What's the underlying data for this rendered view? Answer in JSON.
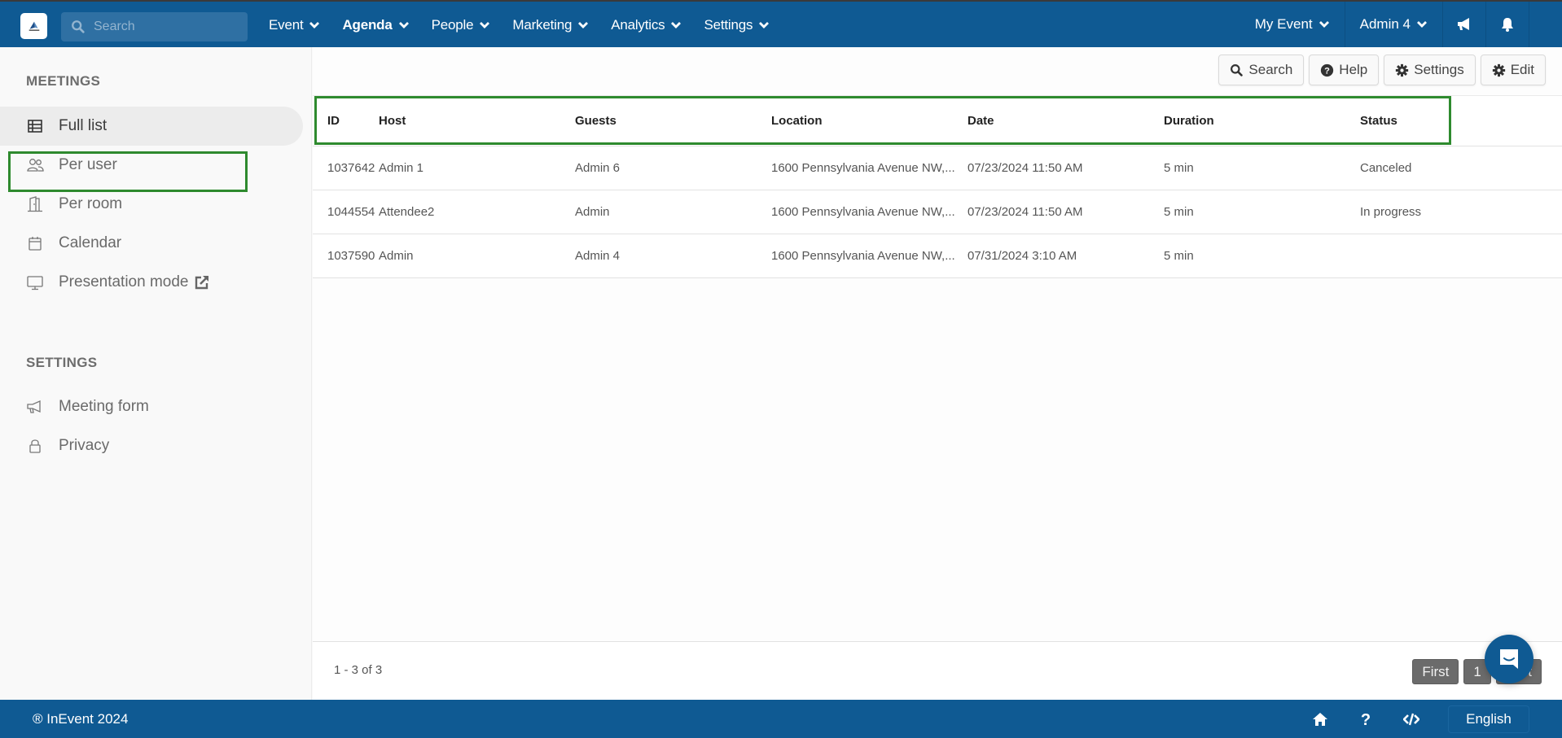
{
  "topbar": {
    "search_placeholder": "Search",
    "nav": [
      {
        "label": "Event",
        "active": false
      },
      {
        "label": "Agenda",
        "active": true
      },
      {
        "label": "People",
        "active": false
      },
      {
        "label": "Marketing",
        "active": false
      },
      {
        "label": "Analytics",
        "active": false
      },
      {
        "label": "Settings",
        "active": false
      }
    ],
    "right": {
      "event_label": "My Event",
      "user_label": "Admin 4",
      "announce_icon": "megaphone-icon",
      "notify_icon": "bell-icon"
    },
    "brand_color": "#0f5a93"
  },
  "sidebar": {
    "meetings_heading": "MEETINGS",
    "meetings_items": [
      {
        "label": "Full list",
        "icon": "table-icon",
        "active": true
      },
      {
        "label": "Per user",
        "icon": "users-icon",
        "active": false
      },
      {
        "label": "Per room",
        "icon": "door-icon",
        "active": false
      },
      {
        "label": "Calendar",
        "icon": "calendar-icon",
        "active": false
      },
      {
        "label": "Presentation mode",
        "icon": "monitor-icon",
        "active": false,
        "external": true
      }
    ],
    "settings_heading": "SETTINGS",
    "settings_items": [
      {
        "label": "Meeting form",
        "icon": "megaphone-icon"
      },
      {
        "label": "Privacy",
        "icon": "lock-icon"
      }
    ]
  },
  "toolbar": {
    "search_label": "Search",
    "help_label": "Help",
    "settings_label": "Settings",
    "edit_label": "Edit"
  },
  "table": {
    "columns": [
      "ID",
      "Host",
      "Guests",
      "Location",
      "Date",
      "Duration",
      "Status"
    ],
    "rows": [
      {
        "id": "1037642",
        "host": "Admin 1",
        "guests": "Admin 6",
        "location": "1600 Pennsylvania Avenue NW,...",
        "date": "07/23/2024 11:50 AM",
        "duration": "5 min",
        "status": "Canceled"
      },
      {
        "id": "1044554",
        "host": "Attendee2",
        "guests": "Admin",
        "location": "1600 Pennsylvania Avenue NW,...",
        "date": "07/23/2024 11:50 AM",
        "duration": "5 min",
        "status": "In progress"
      },
      {
        "id": "1037590",
        "host": "Admin",
        "guests": "Admin 4",
        "location": "1600 Pennsylvania Avenue NW,...",
        "date": "07/31/2024 3:10 AM",
        "duration": "5 min",
        "status": ""
      }
    ],
    "count_text": "1 - 3 of 3",
    "pager": {
      "first_label": "First",
      "page_label": "1",
      "last_label": "Last"
    }
  },
  "footer": {
    "copyright": "® InEvent 2024",
    "language": "English",
    "icons": [
      "home-icon",
      "help-icon",
      "code-icon"
    ]
  },
  "highlight_color": "#2e8a2e"
}
